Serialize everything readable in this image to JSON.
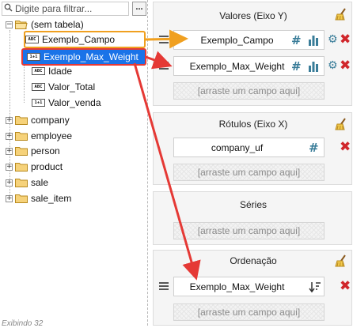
{
  "filter": {
    "placeholder": "Digite para filtrar...",
    "menu_label": "..."
  },
  "tree": {
    "root_label": "(sem tabela)",
    "fields": [
      {
        "label": "Exemplo_Campo",
        "type": "ABC"
      },
      {
        "label": "Exemplo_Max_Weight",
        "type": "1+1"
      },
      {
        "label": "Idade",
        "type": "ABC"
      },
      {
        "label": "Valor_Total",
        "type": "ABC"
      },
      {
        "label": "Valor_venda",
        "type": "1+1"
      }
    ],
    "tables": [
      {
        "label": "company"
      },
      {
        "label": "employee"
      },
      {
        "label": "person"
      },
      {
        "label": "product"
      },
      {
        "label": "sale"
      },
      {
        "label": "sale_item"
      }
    ],
    "footer": "Exibindo 32"
  },
  "sections": {
    "values": {
      "title": "Valores (Eixo Y)",
      "fields": [
        "Exemplo_Campo",
        "Exemplo_Max_Weight"
      ],
      "drop_placeholder": "[arraste um campo aqui]"
    },
    "labels": {
      "title": "Rótulos (Eixo X)",
      "fields": [
        "company_uf"
      ],
      "drop_placeholder": "[arraste um campo aqui]"
    },
    "series": {
      "title": "Séries",
      "drop_placeholder": "[arraste um campo aqui]"
    },
    "ordering": {
      "title": "Ordenação",
      "fields": [
        "Exemplo_Max_Weight"
      ],
      "drop_placeholder": "[arraste um campo aqui]"
    }
  },
  "colors": {
    "selected_row": "#1a73e8",
    "highlight_orange": "#f0a020",
    "highlight_red": "#e53935",
    "icon_teal": "#3a7d99",
    "remove_red": "#d0262b"
  }
}
